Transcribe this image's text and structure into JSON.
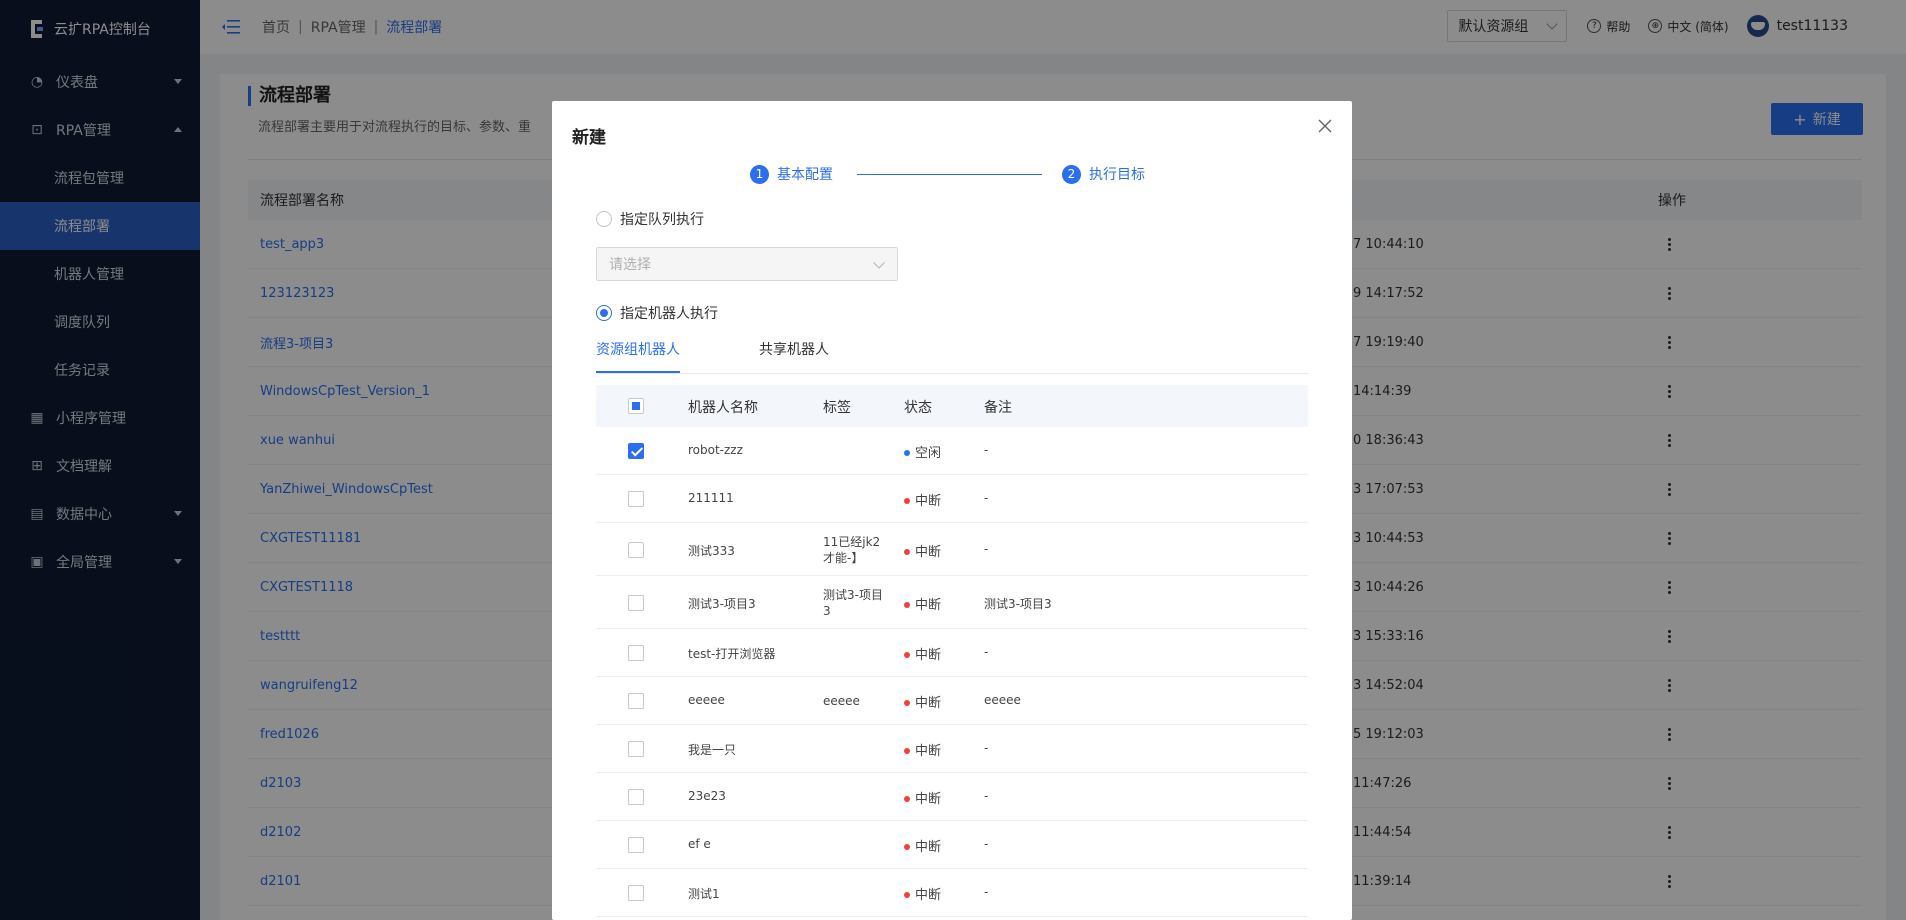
{
  "app": {
    "title": "云扩RPA控制台"
  },
  "sidebar": {
    "items": [
      {
        "label": "仪表盘",
        "icon": "dashboard-icon",
        "caret": "down"
      },
      {
        "label": "RPA管理",
        "icon": "robot-icon",
        "caret": "up"
      },
      {
        "label": "流程包管理",
        "sub": true
      },
      {
        "label": "流程部署",
        "sub": true,
        "active": true
      },
      {
        "label": "机器人管理",
        "sub": true
      },
      {
        "label": "调度队列",
        "sub": true
      },
      {
        "label": "任务记录",
        "sub": true
      },
      {
        "label": "小程序管理",
        "icon": "grid-icon"
      },
      {
        "label": "文档理解",
        "icon": "document-icon"
      },
      {
        "label": "数据中心",
        "icon": "database-icon",
        "caret": "down"
      },
      {
        "label": "全局管理",
        "icon": "settings-icon",
        "caret": "down"
      }
    ]
  },
  "header": {
    "breadcrumb": [
      "首页",
      "RPA管理",
      "流程部署"
    ],
    "resource_group": "默认资源组",
    "help": "帮助",
    "language": "中文 (简体)",
    "username": "test11133"
  },
  "page": {
    "title": "流程部署",
    "description": "流程部署主要用于对流程执行的目标、参数、重",
    "new_button": "新建",
    "columns": [
      "流程部署名称",
      "操作"
    ],
    "rows": [
      {
        "name": "test_app3",
        "time": "7 10:44:10"
      },
      {
        "name": "123123123",
        "time": "9 14:17:52"
      },
      {
        "name": "流程3-项目3",
        "time": "7 19:19:40"
      },
      {
        "name": "WindowsCpTest_Version_1",
        "time": "14:14:39"
      },
      {
        "name": "xue wanhui",
        "time": "0 18:36:43"
      },
      {
        "name": "YanZhiwei_WindowsCpTest",
        "time": "3 17:07:53"
      },
      {
        "name": "CXGTEST11181",
        "time": "3 10:44:53"
      },
      {
        "name": "CXGTEST1118",
        "time": "3 10:44:26"
      },
      {
        "name": "testttt",
        "time": "3 15:33:16"
      },
      {
        "name": "wangruifeng12",
        "time": "3 14:52:04"
      },
      {
        "name": "fred1026",
        "time": "5 19:12:03"
      },
      {
        "name": "d2103",
        "time": "11:47:26"
      },
      {
        "name": "d2102",
        "time": "11:44:54"
      },
      {
        "name": "d2101",
        "time": "11:39:14"
      }
    ]
  },
  "modal": {
    "title": "新建",
    "steps": [
      {
        "num": "1",
        "label": "基本配置"
      },
      {
        "num": "2",
        "label": "执行目标"
      }
    ],
    "option_queue": "指定队列执行",
    "queue_placeholder": "请选择",
    "option_robot": "指定机器人执行",
    "tabs": [
      "资源组机器人",
      "共享机器人"
    ],
    "columns": [
      "机器人名称",
      "标签",
      "状态",
      "备注"
    ],
    "robots": [
      {
        "name": "robot-zzz",
        "tag": "",
        "status": "空闲",
        "status_color": "#2b6ff0",
        "note": "-",
        "checked": true
      },
      {
        "name": "211111",
        "tag": "",
        "status": "中断",
        "status_color": "#f04040",
        "note": "-",
        "checked": false
      },
      {
        "name": "测试333",
        "tag": "11已经jk2才能-】",
        "status": "中断",
        "status_color": "#f04040",
        "note": "-",
        "checked": false
      },
      {
        "name": "测试3-项目3",
        "tag": "测试3-项目3",
        "status": "中断",
        "status_color": "#f04040",
        "note": "测试3-项目3",
        "checked": false
      },
      {
        "name": "test-打开浏览器",
        "tag": "",
        "status": "中断",
        "status_color": "#f04040",
        "note": "-",
        "checked": false
      },
      {
        "name": "eeeee",
        "tag": "eeeee",
        "status": "中断",
        "status_color": "#f04040",
        "note": "eeeee",
        "checked": false
      },
      {
        "name": "我是一只",
        "tag": "",
        "status": "中断",
        "status_color": "#f04040",
        "note": "-",
        "checked": false
      },
      {
        "name": "23e23",
        "tag": "",
        "status": "中断",
        "status_color": "#f04040",
        "note": "-",
        "checked": false
      },
      {
        "name": "ef e",
        "tag": "",
        "status": "中断",
        "status_color": "#f04040",
        "note": "-",
        "checked": false
      },
      {
        "name": "测试1",
        "tag": "",
        "status": "中断",
        "status_color": "#f04040",
        "note": "-",
        "checked": false
      }
    ]
  }
}
